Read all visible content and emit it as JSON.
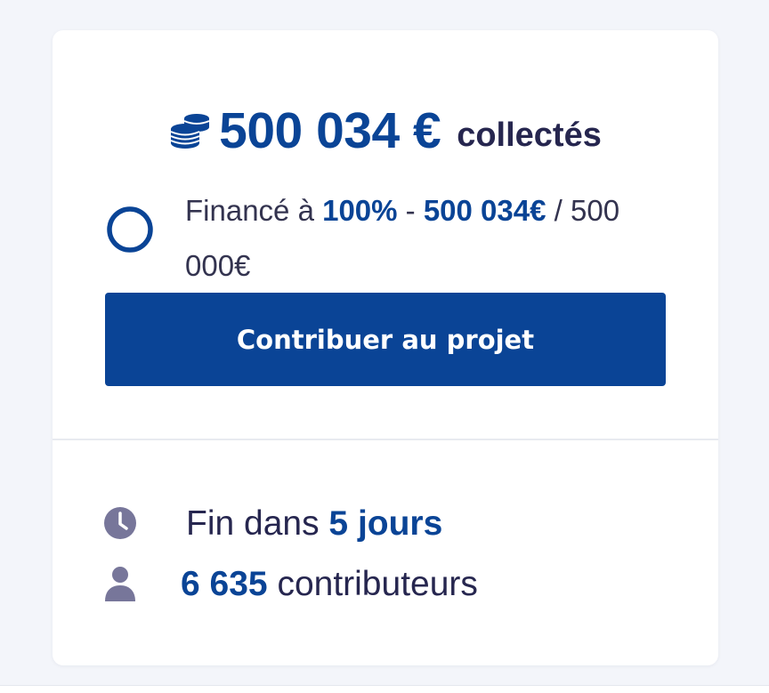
{
  "colors": {
    "accent": "#0a4496",
    "text_dark": "#26264f",
    "icon_grey": "#77769a",
    "background": "#f3f5fa"
  },
  "summary": {
    "icon": "coins-icon",
    "amount": "500 034 €",
    "suffix": "collectés"
  },
  "funding": {
    "icon": "progress-ring-icon",
    "prefix": "Financé à ",
    "percent": "100%",
    "separator": " - ",
    "collected": "500 034€",
    "slash": " / ",
    "goal": "500 000€"
  },
  "cta": {
    "label": "Contribuer au projet"
  },
  "stats": {
    "end": {
      "icon": "clock-icon",
      "prefix": "Fin dans ",
      "value": "5 jours"
    },
    "contributors": {
      "icon": "person-icon",
      "value": "6 635",
      "suffix": " contributeurs"
    }
  }
}
